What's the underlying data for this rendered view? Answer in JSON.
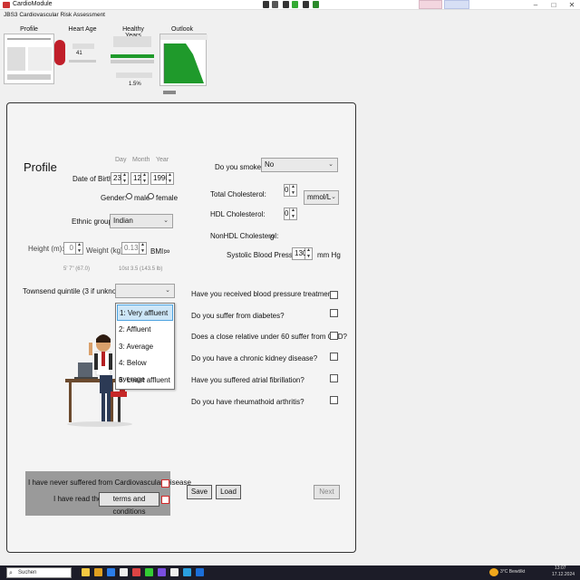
{
  "window": {
    "title": "CardioModule",
    "subtitle": "JBS3 Cardiovascular Risk Assessment",
    "controls": {
      "minimize": "–",
      "maximize": "□",
      "close": "✕"
    }
  },
  "tabs": [
    {
      "label": "Profile"
    },
    {
      "label": "Heart Age"
    },
    {
      "label": "Healthy Years"
    },
    {
      "label": "Outlook"
    }
  ],
  "thumbs": {
    "heart_age_value": "41",
    "healthy_years_percent": "1.5%"
  },
  "profile": {
    "heading": "Profile",
    "dob": {
      "label": "Date of Birth",
      "day_header": "Day",
      "month_header": "Month",
      "year_header": "Year",
      "day": "23",
      "month": "12",
      "year": "1990"
    },
    "gender": {
      "label": "Gender:",
      "male": "male",
      "female": "female"
    },
    "ethnic": {
      "label": "Ethnic group",
      "value": "Indian"
    },
    "height": {
      "label": "Height (m):",
      "value": "0",
      "hint": "5' 7\" (67.0)"
    },
    "weight": {
      "label": "Weight (kg):",
      "value": "0.13",
      "hint": "10st 3.5 (143.5 lb)"
    },
    "bmi": {
      "label": "BMI:",
      "value": "∞"
    },
    "townsend": {
      "label": "Townsend quintile (3 if unknown):",
      "value": "",
      "options": [
        "1: Very affluent",
        "2: Affluent",
        "3: Average",
        "4: Below average",
        "5: Least affluent"
      ],
      "selected_index": 0
    }
  },
  "right": {
    "smoke": {
      "label": "Do you smoke?",
      "value": "No"
    },
    "total_chol": {
      "label": "Total Cholesterol:",
      "value": "0",
      "unit": "mmol/L"
    },
    "hdl": {
      "label": "HDL Cholesterol:",
      "value": "0"
    },
    "nonhdl": {
      "label": "NonHDL Cholesterol:",
      "value": "0"
    },
    "sbp": {
      "label": "Systolic Blood Pressure:",
      "value": "130",
      "unit": "mm Hg"
    }
  },
  "questions": [
    {
      "label": "Have you received blood pressure treatment?",
      "checked": false
    },
    {
      "label": "Do you suffer from diabetes?",
      "checked": false
    },
    {
      "label": "Does a close relative under 60 suffer from CVD?",
      "checked": false
    },
    {
      "label": "Do you have a chronic kidney disease?",
      "checked": false
    },
    {
      "label": "Have you suffered atrial fibrillation?",
      "checked": false
    },
    {
      "label": "Do you have rheumathoid arthritis?",
      "checked": false
    }
  ],
  "consent": {
    "never_cvd": "I have never suffered from Cardiovascular Disease",
    "read_prefix": "I have read the",
    "terms_button": "terms and conditions"
  },
  "buttons": {
    "save": "Save",
    "load": "Load",
    "next": "Next"
  },
  "taskbar": {
    "search_placeholder": "Suchen",
    "weather": "3°C Bewölkt",
    "time": "13:07",
    "date": "17.12.2024"
  },
  "colors": {
    "accent_green": "#1f9a2b",
    "checkbox_red": "#d32a2a",
    "selection_blue": "#cde6f7"
  }
}
